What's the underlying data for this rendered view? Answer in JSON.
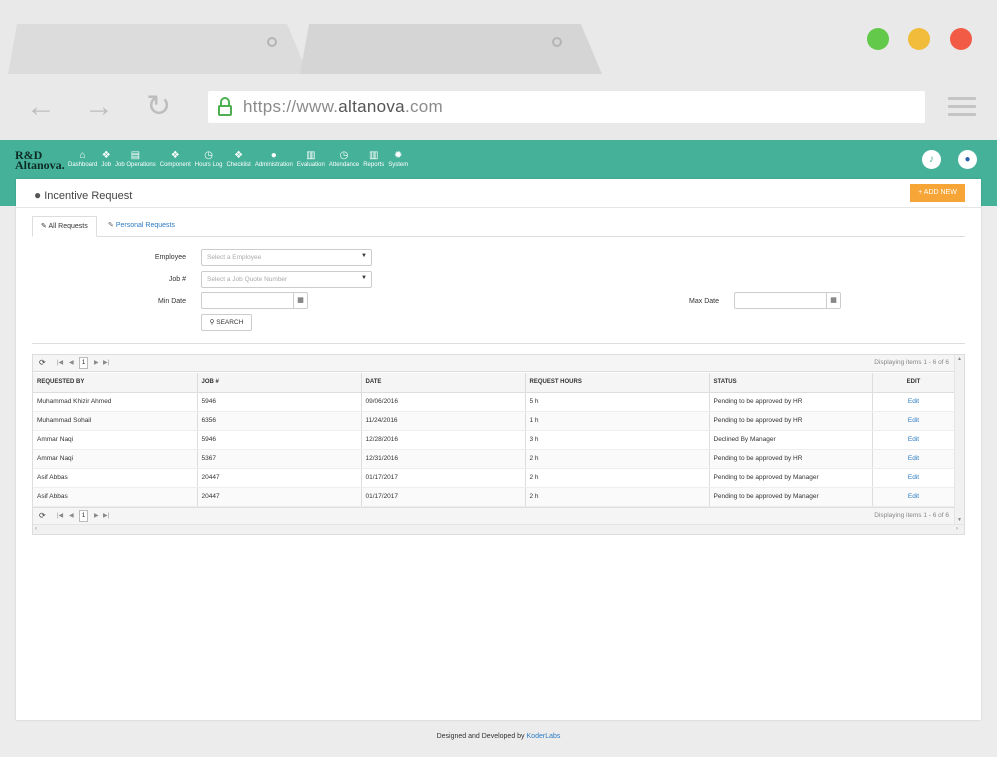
{
  "browser": {
    "url_prefix": "https://www.",
    "url_domain": "altanova",
    "url_suffix": ".com"
  },
  "app": {
    "logo_line1": "R&D",
    "logo_line2": "Altanova.",
    "menu": [
      {
        "label": "Dashboard",
        "icon": "home-icon"
      },
      {
        "label": "Job",
        "icon": "cubes-icon"
      },
      {
        "label": "Job Operations",
        "icon": "clipboard-icon"
      },
      {
        "label": "Component",
        "icon": "cubes-icon"
      },
      {
        "label": "Hours Log",
        "icon": "clock-icon"
      },
      {
        "label": "Checklist",
        "icon": "cubes-icon"
      },
      {
        "label": "Administration",
        "icon": "user-icon"
      },
      {
        "label": "Evaluation",
        "icon": "bar-chart-icon"
      },
      {
        "label": "Attendance",
        "icon": "clock-icon"
      },
      {
        "label": "Reports",
        "icon": "bar-chart-icon"
      },
      {
        "label": "System",
        "icon": "gear-icon"
      }
    ]
  },
  "page": {
    "title": "Incentive Request",
    "add_button": "+ ADD NEW",
    "tabs": {
      "all": "All Requests",
      "personal": "Personal Requests"
    }
  },
  "filters": {
    "employee_label": "Employee",
    "employee_placeholder": "Select a Employee",
    "job_label": "Job #",
    "job_placeholder": "Select a Job Quote Number",
    "min_date_label": "Min Date",
    "max_date_label": "Max Date",
    "search_label": "SEARCH"
  },
  "grid": {
    "page": "1",
    "display_text": "Displaying items 1 - 6 of 6",
    "columns": [
      "REQUESTED BY",
      "JOB #",
      "DATE",
      "REQUEST HOURS",
      "STATUS",
      "EDIT"
    ],
    "rows": [
      [
        "Muhammad Khizir Ahmed",
        "5946",
        "09/06/2016",
        "5 h",
        "Pending to be approved by HR",
        "Edit"
      ],
      [
        "Muhammad Sohail",
        "6356",
        "11/24/2016",
        "1 h",
        "Pending to be approved by HR",
        "Edit"
      ],
      [
        "Ammar Naqi",
        "5946",
        "12/28/2016",
        "3 h",
        "Declined By Manager",
        "Edit"
      ],
      [
        "Ammar Naqi",
        "5367",
        "12/31/2016",
        "2 h",
        "Pending to be approved by HR",
        "Edit"
      ],
      [
        "Asif Abbas",
        "20447",
        "01/17/2017",
        "2 h",
        "Pending to be approved by Manager",
        "Edit"
      ],
      [
        "Asif Abbas",
        "20447",
        "01/17/2017",
        "2 h",
        "Pending to be approved by Manager",
        "Edit"
      ]
    ]
  },
  "footer": {
    "text": "Designed and Developed by ",
    "brand": "KoderLabs"
  },
  "colors": {
    "header": "#45b199",
    "add_button": "#f7a536",
    "link": "#2b7bc3"
  }
}
